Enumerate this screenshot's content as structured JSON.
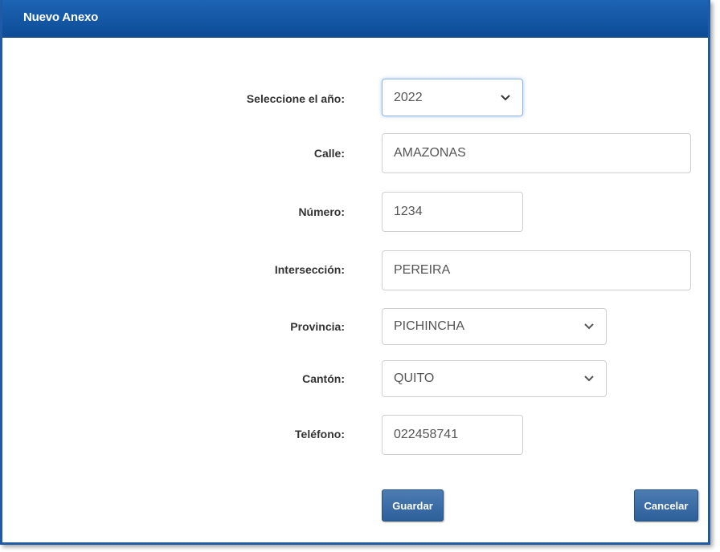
{
  "dialog": {
    "title": "Nuevo Anexo"
  },
  "form": {
    "year": {
      "label": "Seleccione el año:",
      "value": "2022"
    },
    "street": {
      "label": "Calle:",
      "value": "AMAZONAS"
    },
    "number": {
      "label": "Número:",
      "value": "1234"
    },
    "intersection": {
      "label": "Intersección:",
      "value": "PEREIRA"
    },
    "province": {
      "label": "Provincia:",
      "value": "PICHINCHA"
    },
    "canton": {
      "label": "Cantón:",
      "value": "QUITO"
    },
    "phone": {
      "label": "Teléfono:",
      "value": "022458741"
    }
  },
  "buttons": {
    "save": "Guardar",
    "cancel": "Cancelar"
  },
  "colors": {
    "header": "#0d4c96",
    "button": "#2d5f99"
  },
  "icons": {
    "dropdown": "chevron-down-icon"
  }
}
